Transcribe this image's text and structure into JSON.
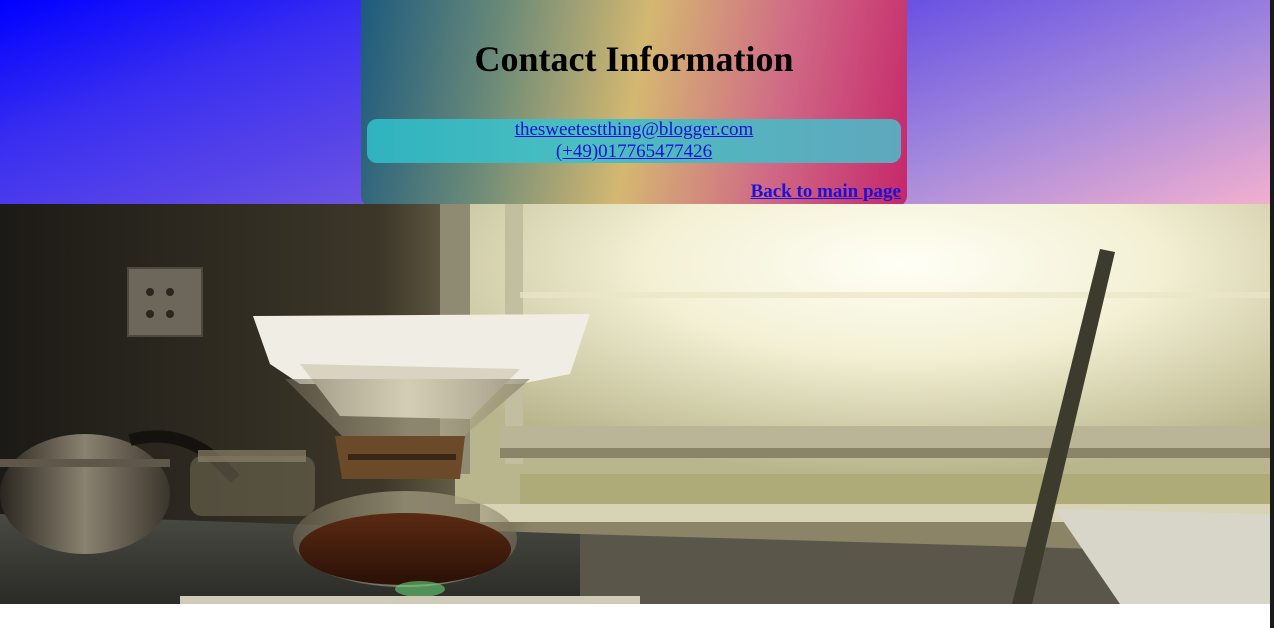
{
  "contact": {
    "title": "Contact Information",
    "email": "thesweetestthing@blogger.com",
    "phone": "(+49)017765477426"
  },
  "navigation": {
    "back_label": "Back to main page"
  },
  "hero_image": {
    "subject": "coffee-brewer-window-photo"
  },
  "colors": {
    "link": "#1a12d8",
    "header_gradient_start": "#0000ff",
    "header_gradient_end": "#f2afcf",
    "card_gradient_start": "#1d5a7e",
    "card_gradient_end": "#c5276a",
    "contact_box": "#2fb3bf"
  }
}
